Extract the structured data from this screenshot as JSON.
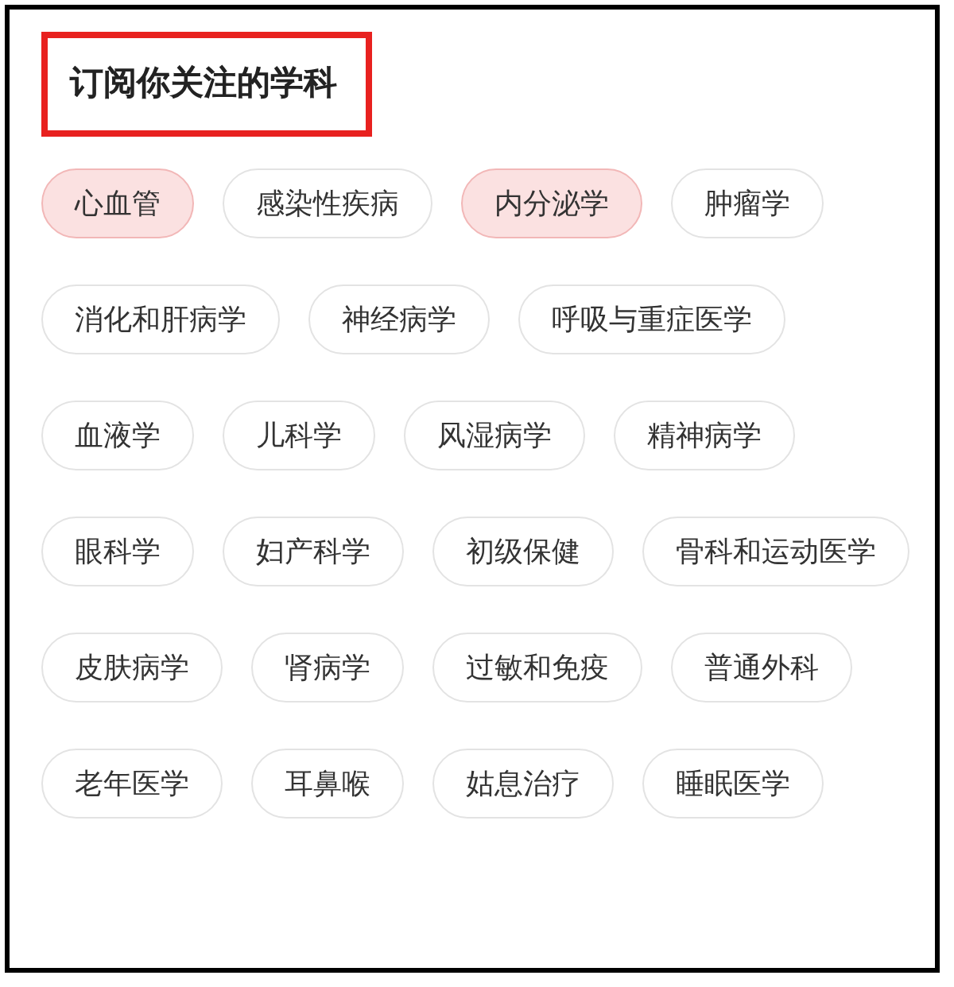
{
  "title": "订阅你关注的学科",
  "subjects": [
    {
      "label": "心血管",
      "selected": true
    },
    {
      "label": "感染性疾病",
      "selected": false
    },
    {
      "label": "内分泌学",
      "selected": true
    },
    {
      "label": "肿瘤学",
      "selected": false
    },
    {
      "label": "消化和肝病学",
      "selected": false
    },
    {
      "label": "神经病学",
      "selected": false
    },
    {
      "label": "呼吸与重症医学",
      "selected": false
    },
    {
      "label": "血液学",
      "selected": false
    },
    {
      "label": "儿科学",
      "selected": false
    },
    {
      "label": "风湿病学",
      "selected": false
    },
    {
      "label": "精神病学",
      "selected": false
    },
    {
      "label": "眼科学",
      "selected": false
    },
    {
      "label": "妇产科学",
      "selected": false
    },
    {
      "label": "初级保健",
      "selected": false
    },
    {
      "label": "骨科和运动医学",
      "selected": false
    },
    {
      "label": "皮肤病学",
      "selected": false
    },
    {
      "label": "肾病学",
      "selected": false
    },
    {
      "label": "过敏和免疫",
      "selected": false
    },
    {
      "label": "普通外科",
      "selected": false
    },
    {
      "label": "老年医学",
      "selected": false
    },
    {
      "label": "耳鼻喉",
      "selected": false
    },
    {
      "label": "姑息治疗",
      "selected": false
    },
    {
      "label": "睡眠医学",
      "selected": false
    }
  ]
}
